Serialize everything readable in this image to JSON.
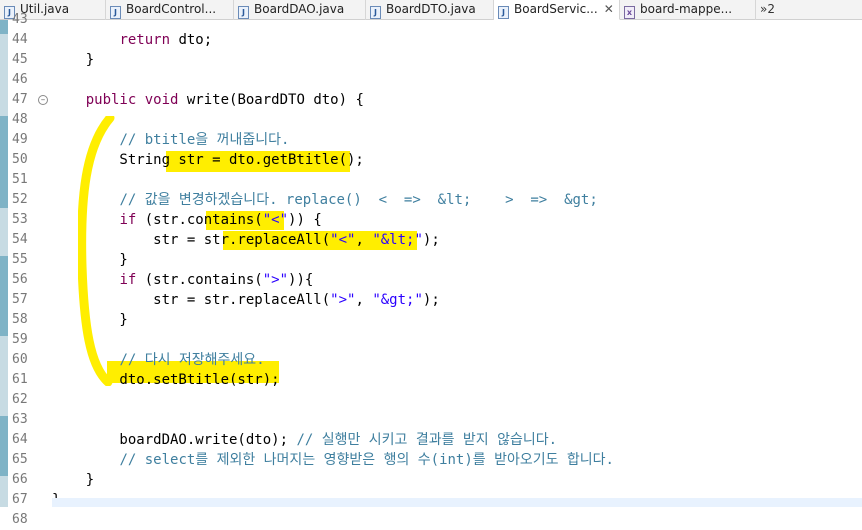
{
  "tabs": [
    {
      "label": "Util.java",
      "icon": "java-file-icon",
      "active": false
    },
    {
      "label": "BoardControl...",
      "icon": "java-file-icon",
      "active": false
    },
    {
      "label": "BoardDAO.java",
      "icon": "java-file-icon",
      "active": false
    },
    {
      "label": "BoardDTO.java",
      "icon": "java-file-icon",
      "active": false
    },
    {
      "label": "BoardServic...",
      "icon": "java-file-icon",
      "active": true
    },
    {
      "label": "board-mappe...",
      "icon": "xml-file-icon",
      "active": false
    }
  ],
  "tab_overflow": "»2",
  "close_glyph": "✕",
  "lines": [
    {
      "n": "43",
      "tokens": []
    },
    {
      "n": "44",
      "tokens": [
        {
          "t": "        "
        },
        {
          "t": "return",
          "c": "kw"
        },
        {
          "t": " dto;"
        }
      ]
    },
    {
      "n": "45",
      "tokens": [
        {
          "t": "    }"
        }
      ]
    },
    {
      "n": "46",
      "tokens": []
    },
    {
      "n": "47",
      "fold": true,
      "tokens": [
        {
          "t": "    "
        },
        {
          "t": "public",
          "c": "kw"
        },
        {
          "t": " "
        },
        {
          "t": "void",
          "c": "kw"
        },
        {
          "t": " write(BoardDTO dto) {"
        }
      ]
    },
    {
      "n": "48",
      "tokens": []
    },
    {
      "n": "49",
      "tokens": [
        {
          "t": "        "
        },
        {
          "t": "// btitle을 꺼내줍니다.",
          "c": "cm"
        }
      ]
    },
    {
      "n": "50",
      "tokens": [
        {
          "t": "        String str = dto.getBtitle();"
        }
      ]
    },
    {
      "n": "51",
      "tokens": []
    },
    {
      "n": "52",
      "tokens": [
        {
          "t": "        "
        },
        {
          "t": "// 값을 변경하겠습니다. replace()  <  =>  &lt;    >  =>  &gt;",
          "c": "cm"
        }
      ]
    },
    {
      "n": "53",
      "tokens": [
        {
          "t": "        "
        },
        {
          "t": "if",
          "c": "kw"
        },
        {
          "t": " (str.contains("
        },
        {
          "t": "\"<\"",
          "c": "st"
        },
        {
          "t": ")) {"
        }
      ]
    },
    {
      "n": "54",
      "tokens": [
        {
          "t": "            str = str.replaceAll("
        },
        {
          "t": "\"<\"",
          "c": "st"
        },
        {
          "t": ", "
        },
        {
          "t": "\"&lt;\"",
          "c": "st"
        },
        {
          "t": ");"
        }
      ]
    },
    {
      "n": "55",
      "tokens": [
        {
          "t": "        }"
        }
      ]
    },
    {
      "n": "56",
      "tokens": [
        {
          "t": "        "
        },
        {
          "t": "if",
          "c": "kw"
        },
        {
          "t": " (str.contains("
        },
        {
          "t": "\">\"",
          "c": "st"
        },
        {
          "t": ")){"
        }
      ]
    },
    {
      "n": "57",
      "tokens": [
        {
          "t": "            str = str.replaceAll("
        },
        {
          "t": "\">\"",
          "c": "st"
        },
        {
          "t": ", "
        },
        {
          "t": "\"&gt;\"",
          "c": "st"
        },
        {
          "t": ");"
        }
      ]
    },
    {
      "n": "58",
      "tokens": [
        {
          "t": "        }"
        }
      ]
    },
    {
      "n": "59",
      "tokens": []
    },
    {
      "n": "60",
      "tokens": [
        {
          "t": "        "
        },
        {
          "t": "// 다시 저장해주세요.",
          "c": "cm"
        }
      ]
    },
    {
      "n": "61",
      "tokens": [
        {
          "t": "        dto.setBtitle(str);"
        }
      ]
    },
    {
      "n": "62",
      "tokens": []
    },
    {
      "n": "63",
      "tokens": []
    },
    {
      "n": "64",
      "tokens": [
        {
          "t": "        boardDAO.write(dto); "
        },
        {
          "t": "// 실행만 시키고 결과를 받지 않습니다.",
          "c": "cm"
        }
      ]
    },
    {
      "n": "65",
      "tokens": [
        {
          "t": "        "
        },
        {
          "t": "// select를 제외한 나머지는 영향받은 행의 수(int)를 받아오기도 합니다.",
          "c": "cm"
        }
      ]
    },
    {
      "n": "66",
      "tokens": [
        {
          "t": "    }"
        }
      ]
    },
    {
      "n": "67",
      "tokens": [
        {
          "t": "}"
        }
      ]
    },
    {
      "n": "68",
      "tokens": []
    }
  ],
  "colors": {
    "keyword": "#7f0055",
    "comment": "#3f7f9f",
    "string": "#2a00ff",
    "highlight": "#ffee00",
    "ruler": "#c7dbe3"
  }
}
